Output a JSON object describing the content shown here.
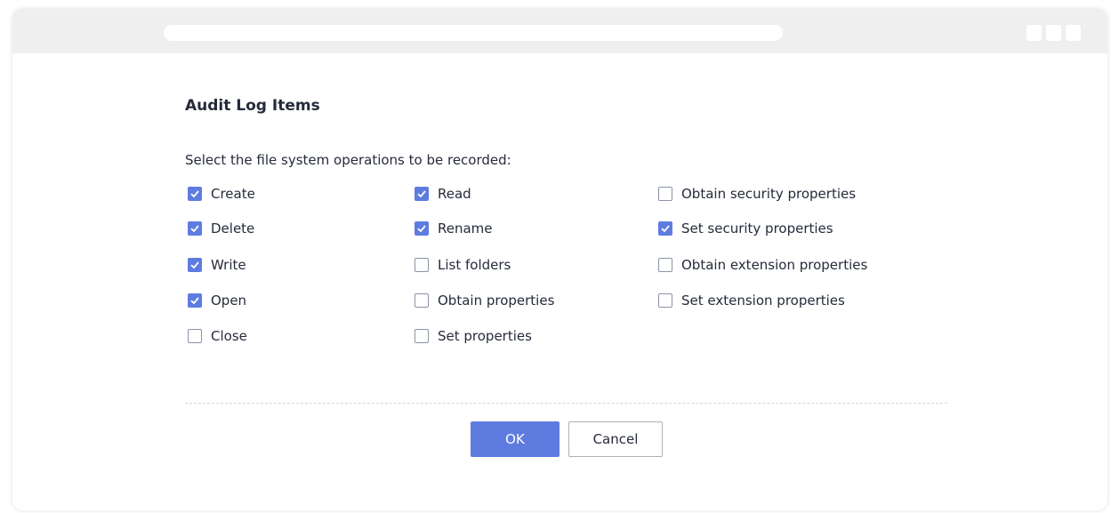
{
  "dialog": {
    "title": "Audit Log Items",
    "instructions": "Select the file system operations to be recorded:"
  },
  "options": [
    {
      "label": "Create",
      "checked": true
    },
    {
      "label": "Delete",
      "checked": true
    },
    {
      "label": "Write",
      "checked": true
    },
    {
      "label": "Open",
      "checked": true
    },
    {
      "label": "Close",
      "checked": false
    },
    {
      "label": "Read",
      "checked": true
    },
    {
      "label": "Rename",
      "checked": true
    },
    {
      "label": "List folders",
      "checked": false
    },
    {
      "label": "Obtain properties",
      "checked": false
    },
    {
      "label": "Set properties",
      "checked": false
    },
    {
      "label": "Obtain security properties",
      "checked": false
    },
    {
      "label": "Set security properties",
      "checked": true
    },
    {
      "label": "Obtain extension properties",
      "checked": false
    },
    {
      "label": "Set extension properties",
      "checked": false
    }
  ],
  "buttons": {
    "ok_label": "OK",
    "cancel_label": "Cancel"
  },
  "colors": {
    "accent": "#5e7ce0",
    "text": "#252b3a",
    "border": "#8a92a6"
  },
  "icons": {
    "checkbox_checked": "checkmark-icon"
  }
}
